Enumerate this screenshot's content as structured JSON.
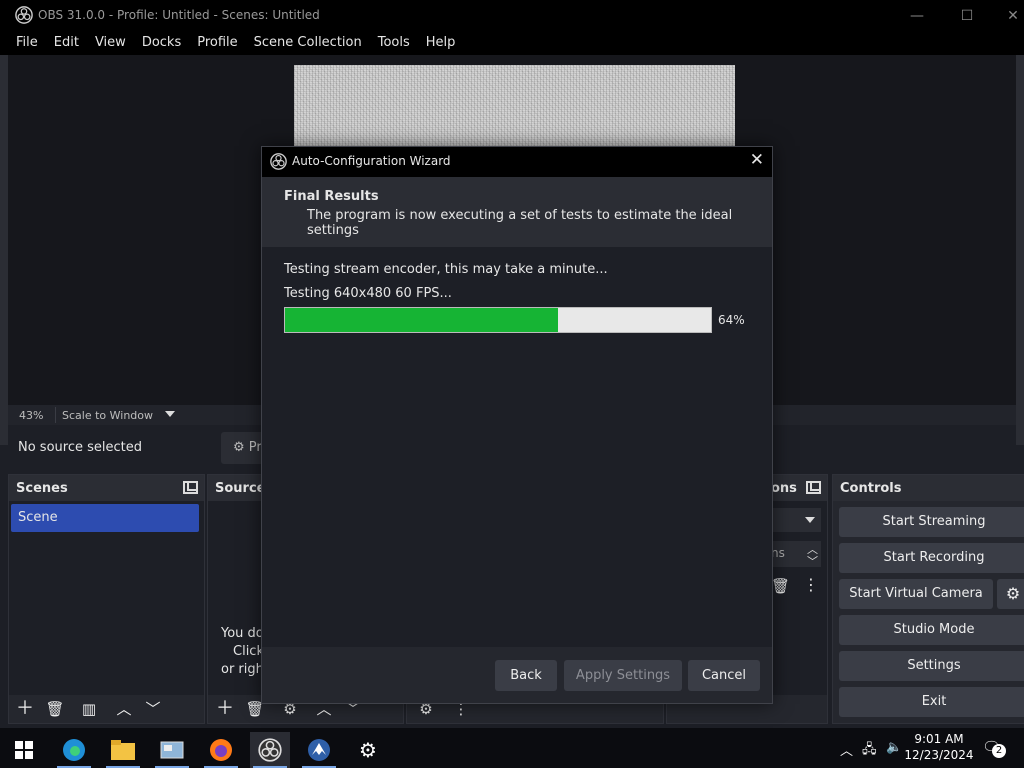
{
  "window": {
    "title": "OBS 31.0.0 - Profile: Untitled - Scenes: Untitled",
    "minimize": "—",
    "maximize": "☐",
    "close": "✕"
  },
  "menu": [
    "File",
    "Edit",
    "View",
    "Docks",
    "Profile",
    "Scene Collection",
    "Tools",
    "Help"
  ],
  "preview": {
    "zoom": "43%",
    "scale_mode": "Scale to Window"
  },
  "source_bar": {
    "status": "No source selected",
    "properties_label": "Pr"
  },
  "docks": {
    "scenes": {
      "title": "Scenes",
      "items": [
        "Scene"
      ]
    },
    "sources": {
      "title": "Source",
      "hint_lines": [
        "You do",
        "Click",
        "or right"
      ]
    },
    "transitions": {
      "title": "ons",
      "duration_unit": "ns"
    },
    "controls": {
      "title": "Controls",
      "buttons": [
        "Start Streaming",
        "Start Recording",
        "Start Virtual Camera",
        "Studio Mode",
        "Settings",
        "Exit"
      ]
    }
  },
  "wizard": {
    "title": "Auto-Configuration Wizard",
    "close": "✕",
    "heading": "Final Results",
    "subheading": "The program is now executing a set of tests to estimate the ideal settings",
    "status_line1": "Testing stream encoder, this may take a minute...",
    "status_line2": "Testing 640x480 60 FPS...",
    "progress_percent": 64,
    "progress_label": "64%",
    "buttons": {
      "back": "Back",
      "apply": "Apply Settings",
      "cancel": "Cancel"
    },
    "colors": {
      "progress_fill": "#16b434",
      "progress_track": "#e8e8e8"
    }
  },
  "taskbar": {
    "apps": [
      "windows-start",
      "edge",
      "file-explorer",
      "control-panel",
      "firefox",
      "obs",
      "nordvpn",
      "settings"
    ],
    "time": "9:01 AM",
    "date": "12/23/2024",
    "notification_count": "2"
  }
}
